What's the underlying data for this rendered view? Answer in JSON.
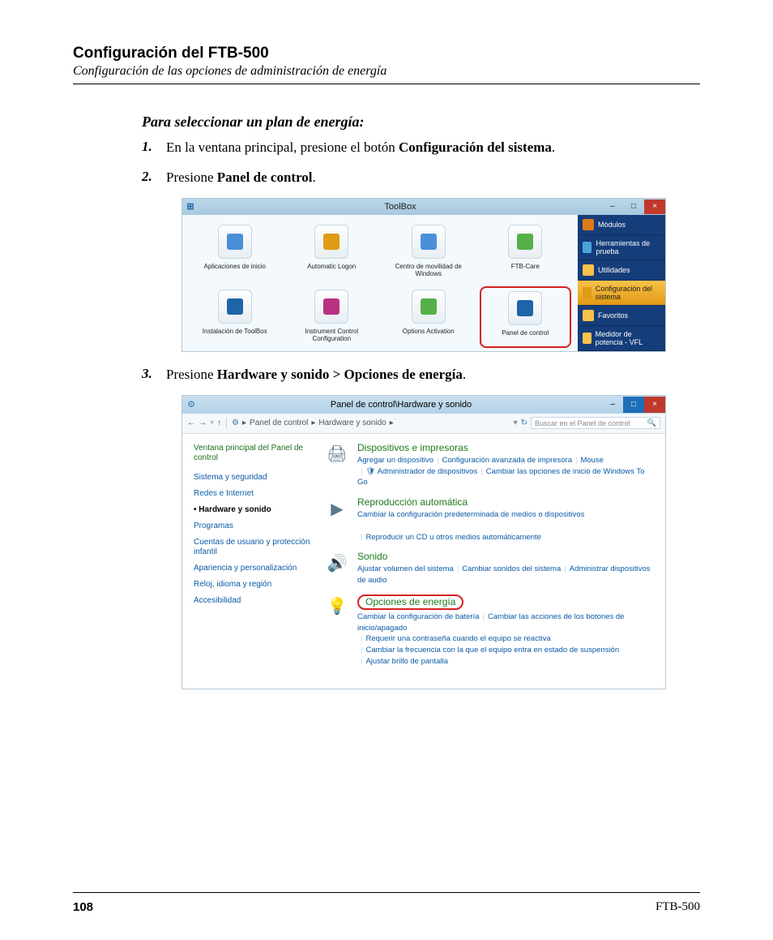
{
  "header": {
    "title": "Configuración del FTB-500",
    "subtitle": "Configuración de las opciones de administración de energía"
  },
  "section_head": "Para seleccionar un plan de energía:",
  "steps": [
    {
      "num": "1.",
      "pre": "En la ventana principal, presione el botón ",
      "bold": "Configuración del sistema",
      "post": "."
    },
    {
      "num": "2.",
      "pre": "Presione ",
      "bold": "Panel de control",
      "post": "."
    },
    {
      "num": "3.",
      "pre": "Presione ",
      "bold": "Hardware y sonido > Opciones de energía",
      "post": "."
    }
  ],
  "toolbox": {
    "title": "ToolBox",
    "min": "–",
    "max": "□",
    "close": "×",
    "grid": [
      {
        "label": "Aplicaciones de inicio"
      },
      {
        "label": "Automatic Logon"
      },
      {
        "label": "Centro de movilidad de Windows"
      },
      {
        "label": "FTB-Care"
      },
      {
        "label": "Instalación de ToolBox"
      },
      {
        "label": "Instrument Control Configuration"
      },
      {
        "label": "Options Activation"
      },
      {
        "label": "Panel de control",
        "highlight": true
      }
    ],
    "side": [
      {
        "label": "Módulos"
      },
      {
        "label": "Herramientas de prueba"
      },
      {
        "label": "Utilidades"
      },
      {
        "label": "Configuración del sistema",
        "active": true
      },
      {
        "label": "Favoritos"
      },
      {
        "label": "Medidor de potencia - VFL"
      }
    ]
  },
  "cp": {
    "title": "Panel de control\\Hardware y sonido",
    "min": "–",
    "max": "□",
    "close": "×",
    "back": "←",
    "fwd": "→",
    "up": "↑",
    "crumb1": "Panel de control",
    "crumb2": "Hardware y sonido",
    "search_placeholder": "Buscar en el Panel de control",
    "refresh": "↻",
    "search_icon": "🔍",
    "side_head": "Ventana principal del Panel de control",
    "side_links": [
      {
        "label": "Sistema y seguridad"
      },
      {
        "label": "Redes e Internet"
      },
      {
        "label": "Hardware y sonido",
        "active": true
      },
      {
        "label": "Programas"
      },
      {
        "label": "Cuentas de usuario y protección infantil"
      },
      {
        "label": "Apariencia y personalización"
      },
      {
        "label": "Reloj, idioma y región"
      },
      {
        "label": "Accesibilidad"
      }
    ],
    "cats": [
      {
        "title": "Dispositivos e impresoras",
        "links": [
          "Agregar un dispositivo",
          "Configuración avanzada de impresora",
          "Mouse",
          "🛡 Administrador de dispositivos",
          "Cambiar las opciones de inicio de Windows To Go"
        ]
      },
      {
        "title": "Reproducción automática",
        "links": [
          "Cambiar la configuración predeterminada de medios o dispositivos",
          "Reproducir un CD u otros medios automáticamente"
        ]
      },
      {
        "title": "Sonido",
        "links": [
          "Ajustar volumen del sistema",
          "Cambiar sonidos del sistema",
          "Administrar dispositivos de audio"
        ]
      },
      {
        "title": "Opciones de energía",
        "highlight": true,
        "links": [
          "Cambiar la configuración de batería",
          "Cambiar las acciones de los botones de inicio/apagado",
          "Requerir una contraseña cuando el equipo se reactiva",
          "Cambiar la frecuencia con la que el equipo entra en estado de suspensión",
          "Ajustar brillo de pantalla"
        ]
      }
    ]
  },
  "footer": {
    "page": "108",
    "model": "FTB-500"
  }
}
